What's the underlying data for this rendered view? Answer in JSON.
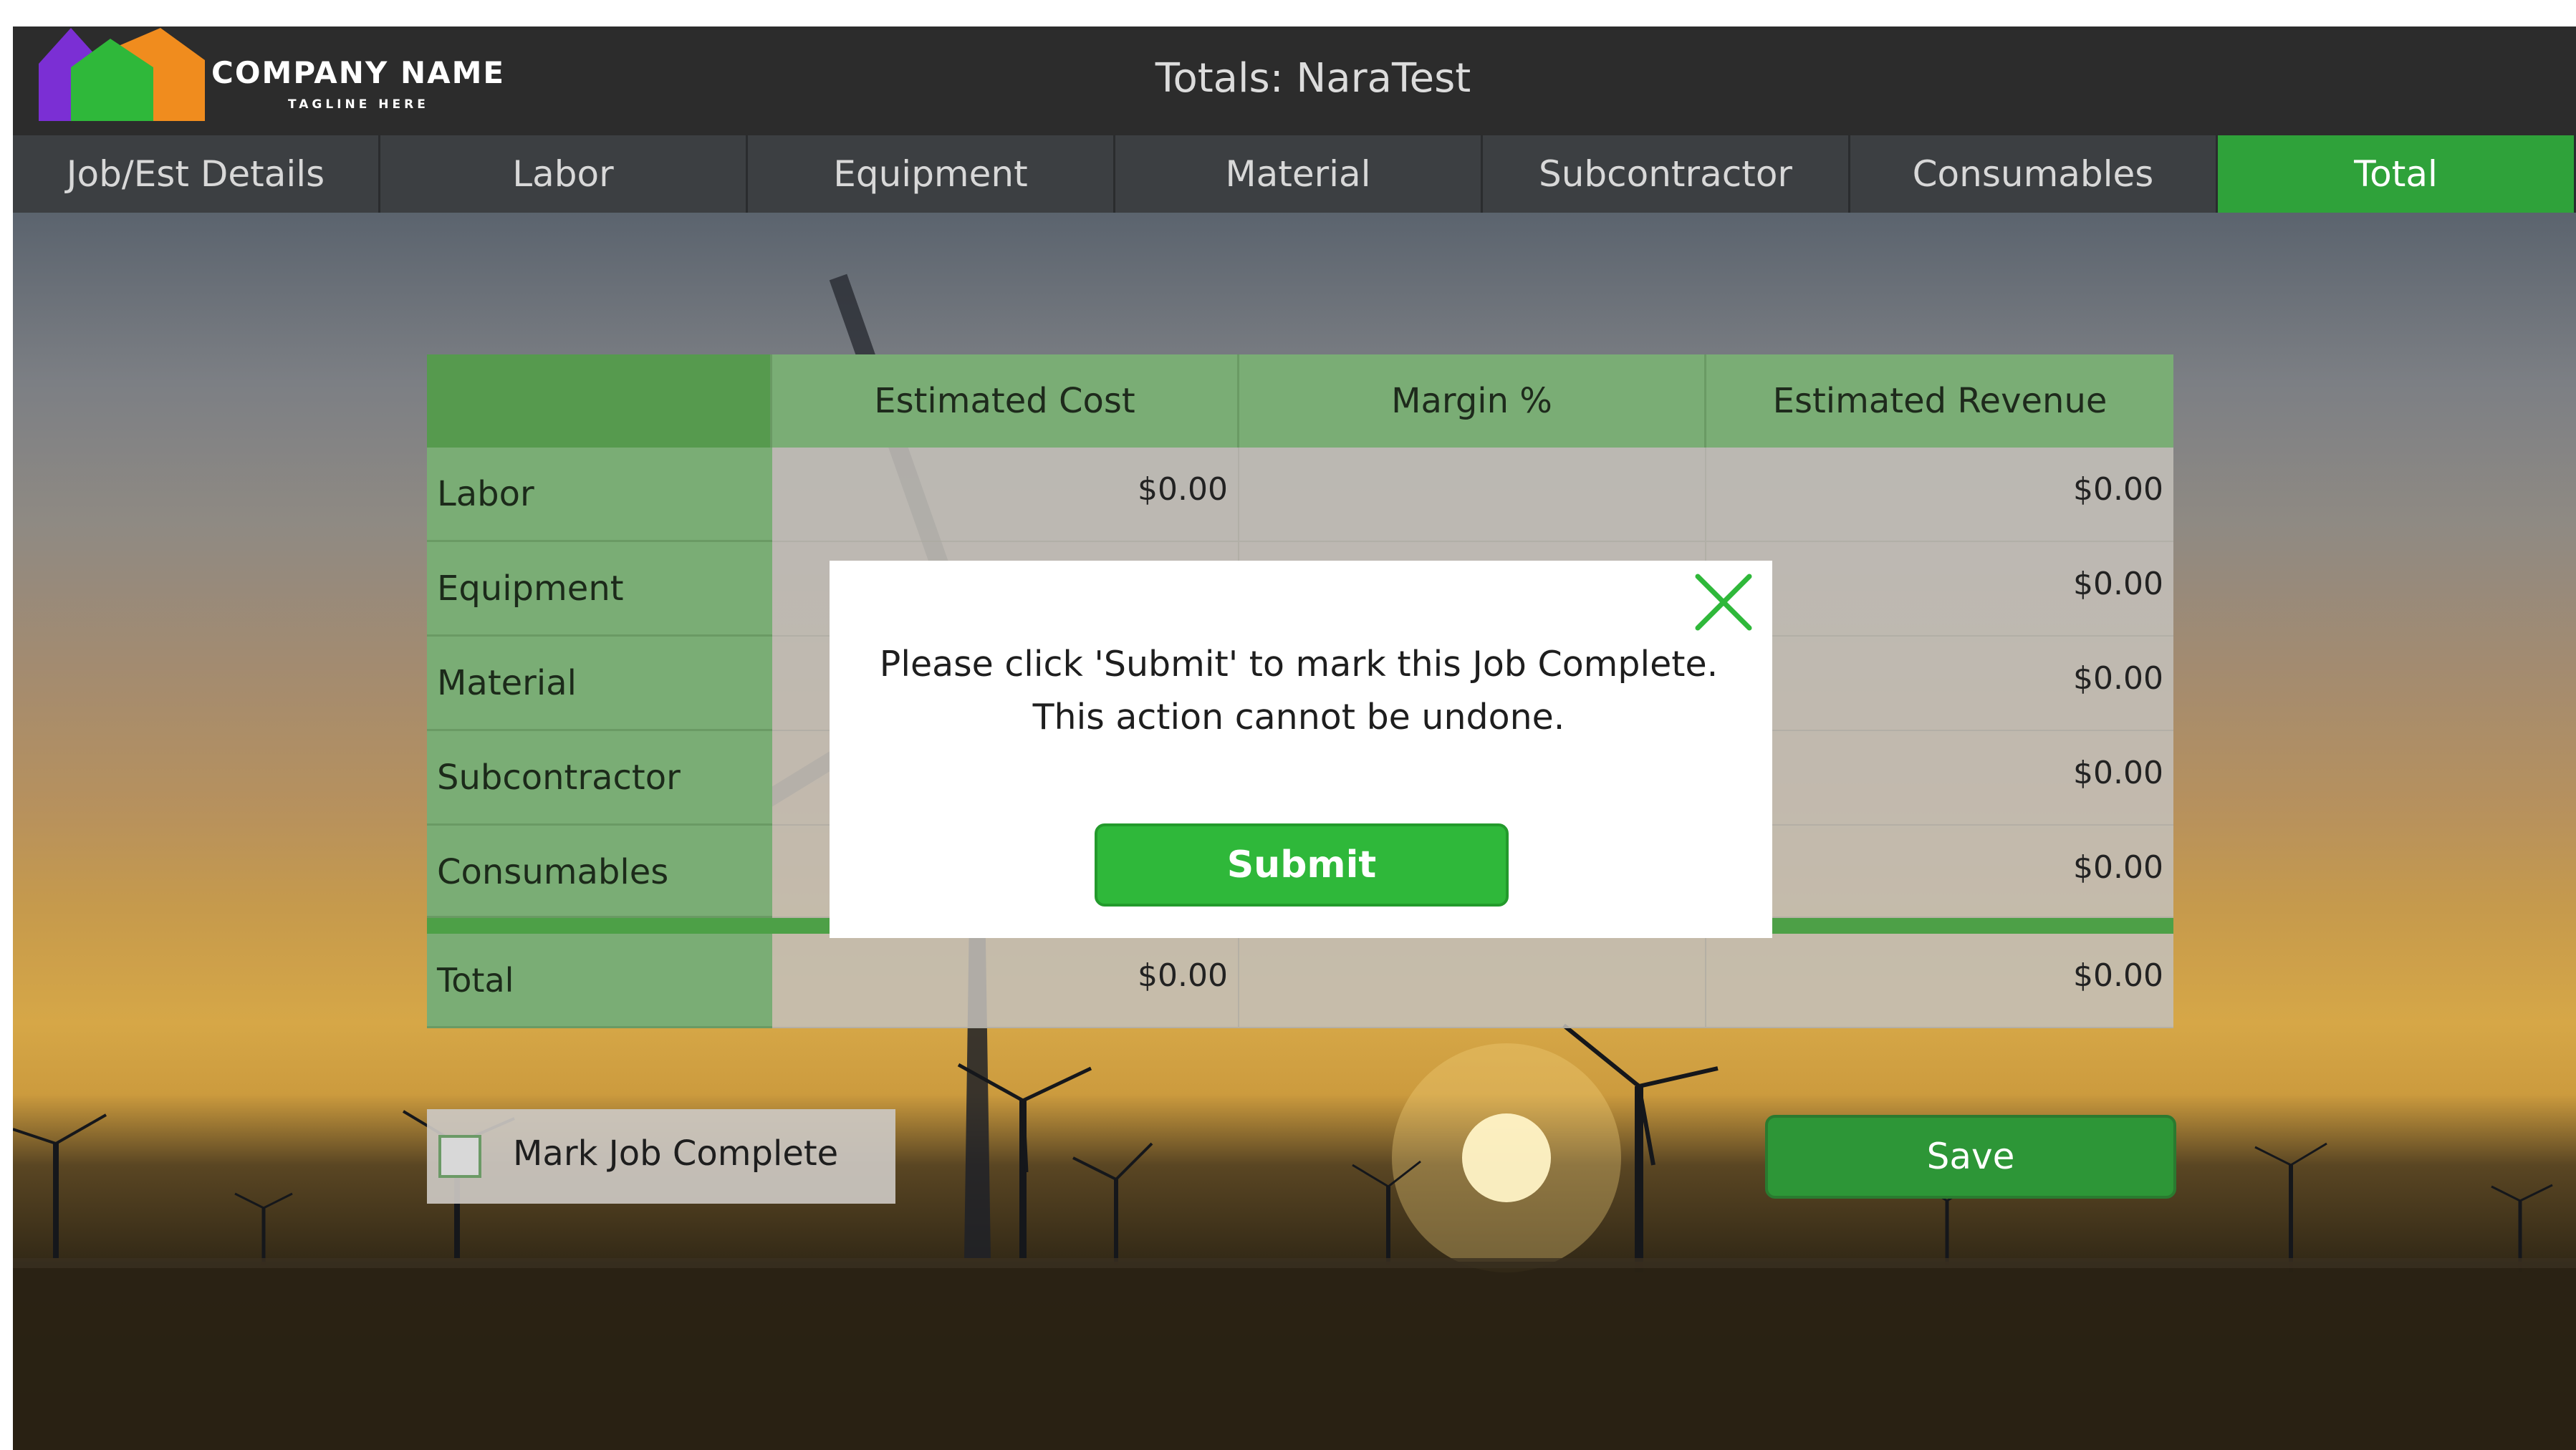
{
  "brand": {
    "company_name": "COMPANY NAME",
    "tagline": "TAGLINE HERE",
    "logo_icon": "house-logo-icon",
    "logo_colors": [
      "#7b2fd4",
      "#2fb83a",
      "#f08c1e"
    ]
  },
  "header": {
    "title": "Totals: NaraTest"
  },
  "tabs": [
    {
      "label": "Job/Est Details",
      "active": false
    },
    {
      "label": "Labor",
      "active": false
    },
    {
      "label": "Equipment",
      "active": false
    },
    {
      "label": "Material",
      "active": false
    },
    {
      "label": "Subcontractor",
      "active": false
    },
    {
      "label": "Consumables",
      "active": false
    },
    {
      "label": "Total",
      "active": true
    }
  ],
  "table": {
    "columns": [
      "Estimated Cost",
      "Margin %",
      "Estimated Revenue"
    ],
    "rows": [
      {
        "label": "Labor",
        "estimated_cost": "$0.00",
        "margin": "",
        "estimated_revenue": "$0.00"
      },
      {
        "label": "Equipment",
        "estimated_cost": "",
        "margin": "",
        "estimated_revenue": "$0.00"
      },
      {
        "label": "Material",
        "estimated_cost": "",
        "margin": "",
        "estimated_revenue": "$0.00"
      },
      {
        "label": "Subcontractor",
        "estimated_cost": "",
        "margin": "",
        "estimated_revenue": "$0.00"
      },
      {
        "label": "Consumables",
        "estimated_cost": "",
        "margin": "",
        "estimated_revenue": "$0.00"
      }
    ],
    "total": {
      "label": "Total",
      "estimated_cost": "$0.00",
      "margin": "",
      "estimated_revenue": "$0.00"
    }
  },
  "mark_complete": {
    "label": "Mark Job Complete",
    "checked": false
  },
  "save_label": "Save",
  "modal": {
    "message": "Please click 'Submit' to mark this Job Complete. This action cannot be undone.",
    "submit_label": "Submit",
    "close_icon": "close-icon"
  },
  "colors": {
    "accent_green": "#2fa23a",
    "header_dark": "#2c2c2c",
    "tab_inactive": "#3c3f42",
    "table_green": "#7aad75"
  }
}
